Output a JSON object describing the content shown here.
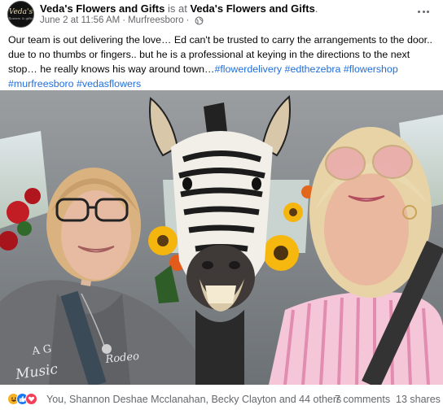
{
  "post": {
    "author": "Veda's Flowers and Gifts",
    "author_connector": " is at ",
    "location": "Veda's Flowers and Gifts",
    "location_suffix": ".",
    "avatar_text": "Veda's",
    "avatar_subtext": "flowers & gifts",
    "timestamp": "June 2 at 11:56 AM",
    "separator": "·",
    "place": "Murfreesboro",
    "text_body": "Our team is out delivering the love… Ed can't be trusted to carry the arrangements to the door.. due to no thumbs or fingers.. but he is a professional at keying in the directions to the next stop… he really knows his way around town…",
    "hashtags": [
      "#flowerdelivery",
      "#edthezebra",
      "#flowershop",
      "#murfreesboro",
      "#vedasflowers"
    ],
    "privacy_icon": "globe-icon",
    "menu_icon": "more-horizontal-icon"
  },
  "photo": {
    "shirt_text_left_1": "A G",
    "shirt_text_left_2": "Music",
    "shirt_text_right": "Rodeo"
  },
  "engagement": {
    "reaction_icons": [
      "haha-icon",
      "like-icon",
      "love-icon"
    ],
    "reactions_text": "You, Shannon Deshae Mcclanahan, Becky Clayton and 44 others",
    "comments_text": "7 comments",
    "shares_text": "13 shares"
  },
  "colors": {
    "link": "#216fdb",
    "muted": "#65676b",
    "like": "#1877f2",
    "love": "#f33e58",
    "haha": "#f7b125"
  }
}
